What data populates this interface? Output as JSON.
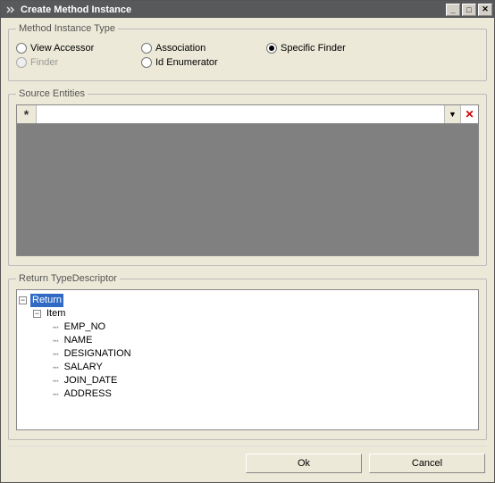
{
  "window": {
    "title": "Create Method Instance"
  },
  "method_type": {
    "legend": "Method Instance Type",
    "options": {
      "view_accessor": "View Accessor",
      "association": "Association",
      "specific_finder": "Specific Finder",
      "finder": "Finder",
      "id_enumerator": "Id Enumerator"
    },
    "selected": "specific_finder",
    "disabled": [
      "finder"
    ]
  },
  "source_entities": {
    "legend": "Source Entities",
    "rowhead_glyph": "*",
    "value": "",
    "dropdown_glyph": "▼",
    "delete_glyph": "✕"
  },
  "return_type": {
    "legend": "Return TypeDescriptor",
    "root": "Return",
    "item_label": "Item",
    "fields": [
      "EMP_NO",
      "NAME",
      "DESIGNATION",
      "SALARY",
      "JOIN_DATE",
      "ADDRESS"
    ]
  },
  "buttons": {
    "ok": "Ok",
    "cancel": "Cancel"
  },
  "win_controls": {
    "min": "_",
    "max": "□",
    "close": "✕"
  }
}
